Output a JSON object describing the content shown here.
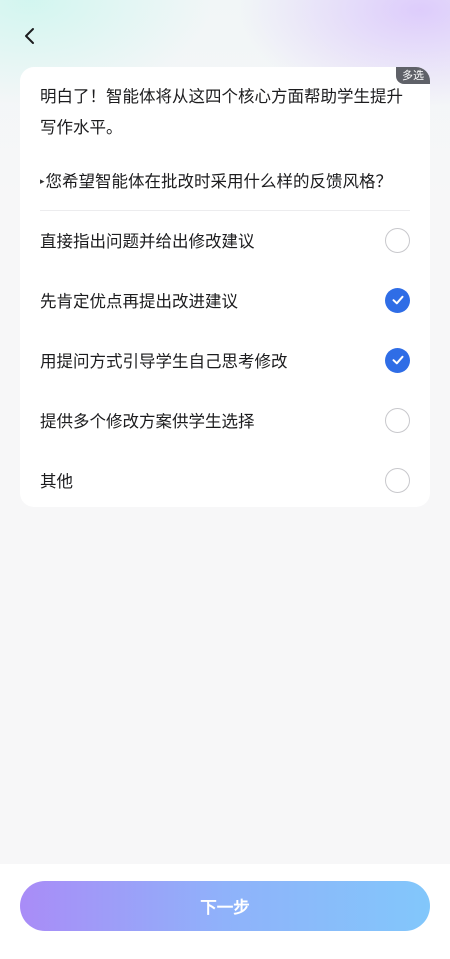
{
  "header": {
    "back_icon": "chevron-left-icon"
  },
  "card": {
    "badge": "多选",
    "intro": "明白了！智能体将从这四个核心方面帮助学生提升写作水平。",
    "question_marker": "▸",
    "question": "您希望智能体在批改时采用什么样的反馈风格？",
    "options": [
      {
        "label": "直接指出问题并给出修改建议",
        "checked": false
      },
      {
        "label": "先肯定优点再提出改进建议",
        "checked": true
      },
      {
        "label": "用提问方式引导学生自己思考修改",
        "checked": true
      },
      {
        "label": "提供多个修改方案供学生选择",
        "checked": false
      },
      {
        "label": "其他",
        "checked": false
      }
    ]
  },
  "footer": {
    "next_label": "下一步"
  },
  "colors": {
    "accent": "#2f6de6",
    "button_gradient_start": "#a98cf7",
    "button_gradient_end": "#82c7fb",
    "badge_bg": "#5f6168"
  }
}
